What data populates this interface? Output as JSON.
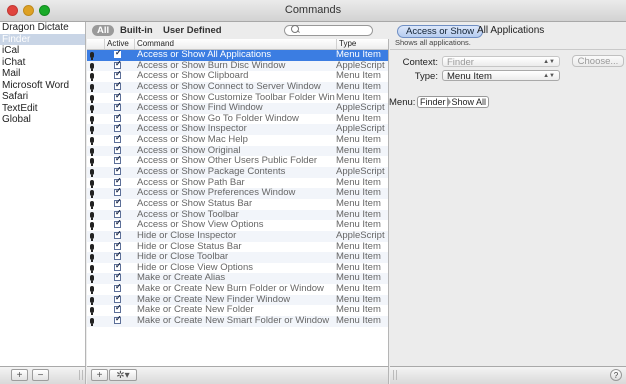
{
  "window": {
    "title": "Commands"
  },
  "sidebar": {
    "apps": [
      "Dragon Dictate",
      "Finder",
      "iCal",
      "iChat",
      "Mail",
      "Microsoft Word",
      "Safari",
      "TextEdit",
      "Global"
    ],
    "selected_index": 1,
    "footer": {
      "add_label": "+",
      "remove_label": "−"
    }
  },
  "filter": {
    "segments": [
      "All",
      "Built-in",
      "User Defined"
    ],
    "active": "All",
    "search_placeholder": ""
  },
  "table": {
    "columns": [
      "Active",
      "Command",
      "Type"
    ],
    "rows": [
      {
        "command": "Access or Show All Applications",
        "type": "Menu Item"
      },
      {
        "command": "Access or Show Burn Disc Window",
        "type": "AppleScript"
      },
      {
        "command": "Access or Show Clipboard",
        "type": "Menu Item"
      },
      {
        "command": "Access or Show Connect to Server Window",
        "type": "Menu Item"
      },
      {
        "command": "Access or Show Customize Toolbar Folder Window",
        "type": "Menu Item"
      },
      {
        "command": "Access or Show Find Window",
        "type": "AppleScript"
      },
      {
        "command": "Access or Show Go To Folder Window",
        "type": "Menu Item"
      },
      {
        "command": "Access or Show Inspector",
        "type": "AppleScript"
      },
      {
        "command": "Access or Show Mac Help",
        "type": "Menu Item"
      },
      {
        "command": "Access or Show Original",
        "type": "Menu Item"
      },
      {
        "command": "Access or Show Other Users Public Folder",
        "type": "Menu Item"
      },
      {
        "command": "Access or Show Package Contents",
        "type": "AppleScript"
      },
      {
        "command": "Access or Show Path Bar",
        "type": "Menu Item"
      },
      {
        "command": "Access or Show Preferences Window",
        "type": "Menu Item"
      },
      {
        "command": "Access or Show Status Bar",
        "type": "Menu Item"
      },
      {
        "command": "Access or Show Toolbar",
        "type": "Menu Item"
      },
      {
        "command": "Access or Show View Options",
        "type": "Menu Item"
      },
      {
        "command": "Hide or Close Inspector",
        "type": "AppleScript"
      },
      {
        "command": "Hide or Close Status Bar",
        "type": "Menu Item"
      },
      {
        "command": "Hide or Close Toolbar",
        "type": "Menu Item"
      },
      {
        "command": "Hide or Close View Options",
        "type": "Menu Item"
      },
      {
        "command": "Make or Create Alias",
        "type": "Menu Item"
      },
      {
        "command": "Make or Create New Burn Folder or Window",
        "type": "Menu Item"
      },
      {
        "command": "Make or Create New Finder Window",
        "type": "Menu Item"
      },
      {
        "command": "Make or Create New Folder",
        "type": "Menu Item"
      },
      {
        "command": "Make or Create New Smart Folder or Window",
        "type": "Menu Item"
      }
    ],
    "selected_index": 0,
    "footer": {
      "add_label": "+",
      "gear_label": "✲▾"
    }
  },
  "detail": {
    "command_button": "Access or Show",
    "command_rest": "All Applications",
    "description": "Shows all applications.",
    "context_label": "Context:",
    "context_value": "Finder",
    "choose_label": "Choose...",
    "type_label": "Type:",
    "type_value": "Menu Item",
    "menu_label": "Menu:",
    "menu_path": [
      "Finder",
      "Show All"
    ],
    "help_label": "?"
  }
}
